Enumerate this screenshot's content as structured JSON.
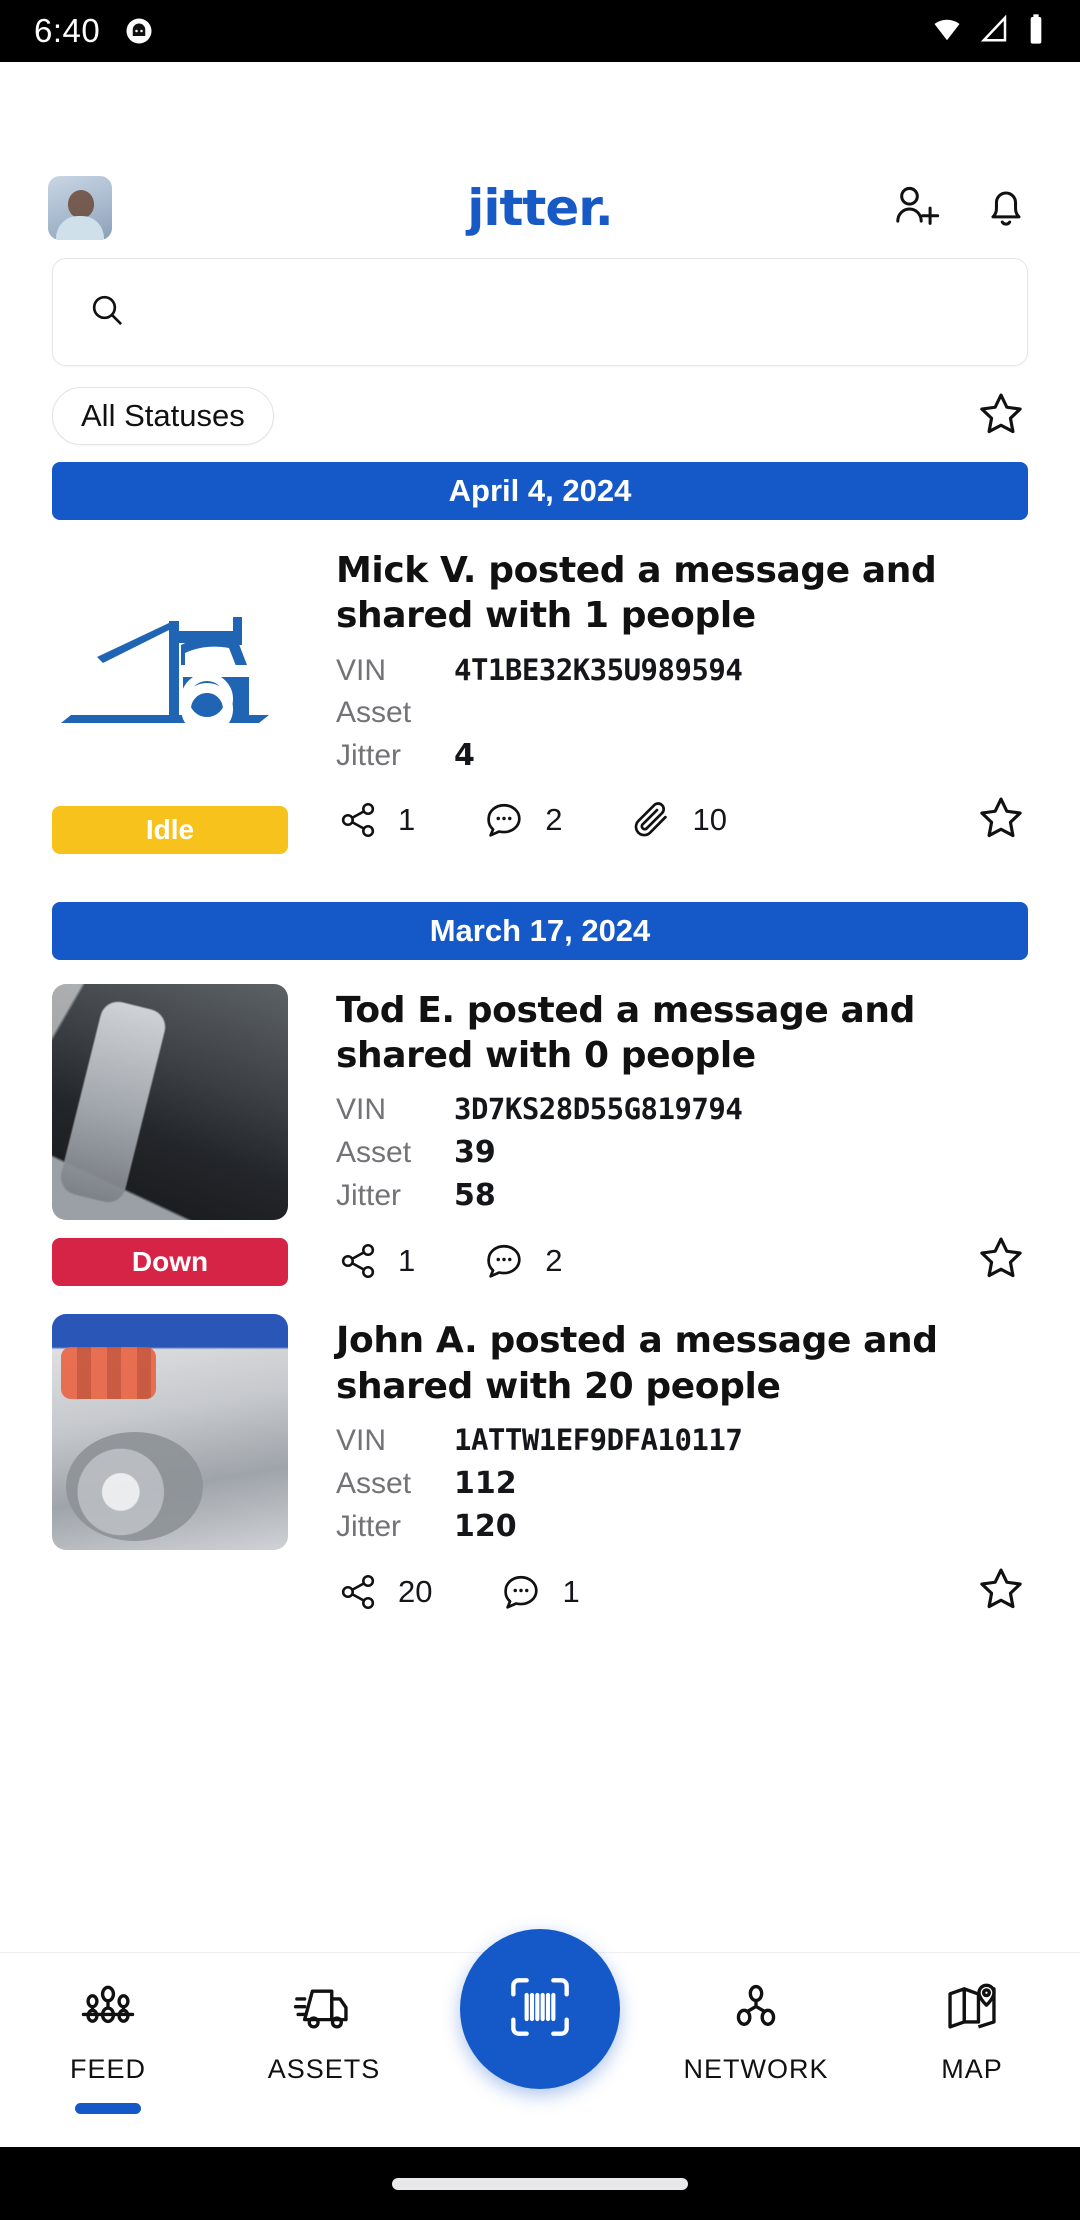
{
  "status_bar": {
    "time": "6:40",
    "notification_icon": "android-mascot-icon",
    "wifi_icon": "wifi-icon",
    "signal_icon": "cellular-signal-icon",
    "battery_icon": "battery-full-icon"
  },
  "header": {
    "avatar_label": "profile-avatar",
    "logo_text": "jitter",
    "logo_dot": ".",
    "logo_color": "#1759c5",
    "add_person_icon": "add-person-icon",
    "notifications_icon": "bell-icon"
  },
  "search": {
    "value": "",
    "placeholder": "",
    "icon": "search-icon"
  },
  "filters": {
    "status_chip_label": "All Statuses",
    "favorites_icon": "star-outline-icon"
  },
  "feed": {
    "groups": [
      {
        "date": "April 4, 2024",
        "posts": [
          {
            "title": "Mick  V. posted a message and shared with 1 people",
            "thumb": "semi-truck-illustration",
            "status_badge": "Idle",
            "status_color": "#f7c21c",
            "fields": [
              {
                "key": "VIN",
                "value": "4T1BE32K35U989594"
              },
              {
                "key": "Asset",
                "value": ""
              },
              {
                "key": "Jitter",
                "value": "4"
              }
            ],
            "actions": {
              "share_count": "1",
              "comment_count": "2",
              "attachment_count": "10",
              "favorite_icon": "star-outline-icon"
            }
          }
        ]
      },
      {
        "date": "March 17, 2024",
        "posts": [
          {
            "title": "Tod E. posted a message and shared with 0 people",
            "thumb": "exhaust-photo",
            "status_badge": "Down",
            "status_color": "#d62446",
            "fields": [
              {
                "key": "VIN",
                "value": "3D7KS28D55G819794"
              },
              {
                "key": "Asset",
                "value": "39"
              },
              {
                "key": "Jitter",
                "value": "58"
              }
            ],
            "actions": {
              "share_count": "1",
              "comment_count": "2",
              "attachment_count": "",
              "favorite_icon": "star-outline-icon"
            }
          },
          {
            "title": "John A. posted a message and shared with 20 people",
            "thumb": "engine-photo",
            "status_badge": "",
            "status_color": "",
            "fields": [
              {
                "key": "VIN",
                "value": "1ATTW1EF9DFA10117"
              },
              {
                "key": "Asset",
                "value": "112"
              },
              {
                "key": "Jitter",
                "value": "120"
              }
            ],
            "actions": {
              "share_count": "20",
              "comment_count": "1",
              "attachment_count": "",
              "favorite_icon": "star-outline-icon"
            }
          }
        ]
      }
    ]
  },
  "bottom_nav": {
    "active": "FEED",
    "accent_color": "#1559c9",
    "items": [
      {
        "label": "FEED",
        "icon": "feed-nodes-icon"
      },
      {
        "label": "ASSETS",
        "icon": "truck-icon"
      },
      {
        "label": "",
        "icon": "barcode-scan-icon"
      },
      {
        "label": "NETWORK",
        "icon": "network-graph-icon"
      },
      {
        "label": "MAP",
        "icon": "map-pin-icon"
      }
    ],
    "scan_button_icon": "barcode-scan-icon"
  },
  "system_nav": {
    "home_indicator": "home-gesture-bar"
  }
}
